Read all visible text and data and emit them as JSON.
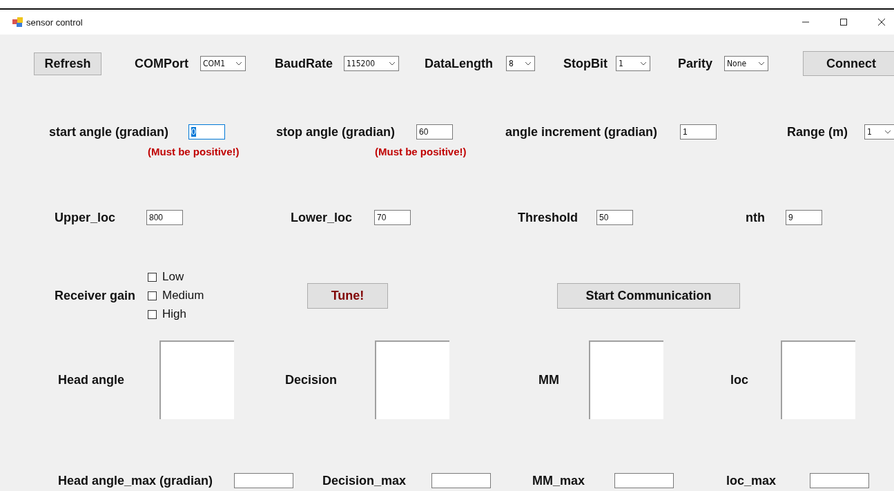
{
  "window": {
    "title": "sensor control"
  },
  "connection": {
    "refresh": "Refresh",
    "connect": "Connect",
    "settings": [
      {
        "label": "COMPort",
        "value": "COM1"
      },
      {
        "label": "BaudRate",
        "value": "115200"
      },
      {
        "label": "DataLength",
        "value": "8"
      },
      {
        "label": "StopBit",
        "value": "1"
      },
      {
        "label": "Parity",
        "value": "None"
      }
    ]
  },
  "angles": [
    {
      "label": "start angle (gradian)",
      "value": "0",
      "focused": true,
      "warning": "(Must be positive!)"
    },
    {
      "label": "stop angle (gradian)",
      "value": "60",
      "focused": false,
      "warning": "(Must be positive!)"
    },
    {
      "label": "angle increment (gradian)",
      "value": "1",
      "focused": false
    }
  ],
  "range": {
    "label": "Range (m)",
    "value": "1"
  },
  "limits": [
    {
      "label": "Upper_loc",
      "value": "800"
    },
    {
      "label": "Lower_loc",
      "value": "70"
    },
    {
      "label": "Threshold",
      "value": "50"
    },
    {
      "label": "nth",
      "value": "9"
    }
  ],
  "receiver_gain": {
    "label": "Receiver gain",
    "options": [
      {
        "label": "Low",
        "checked": false
      },
      {
        "label": "Medium",
        "checked": false
      },
      {
        "label": "High",
        "checked": false
      }
    ]
  },
  "tune_button": "Tune!",
  "start_button": "Start Communication",
  "outputs": [
    {
      "label": "Head angle"
    },
    {
      "label": "Decision"
    },
    {
      "label": "MM"
    },
    {
      "label": "loc"
    }
  ],
  "maxima": [
    {
      "label": "Head angle_max (gradian)"
    },
    {
      "label": "Decision_max"
    },
    {
      "label": "MM_max"
    },
    {
      "label": "loc_max"
    }
  ]
}
